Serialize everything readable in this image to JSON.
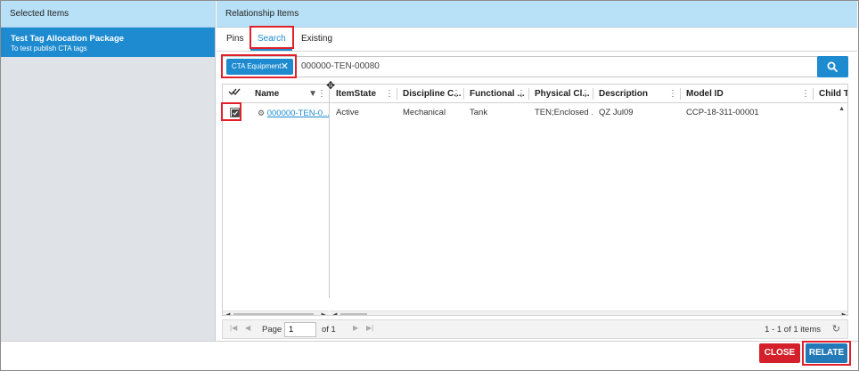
{
  "left_panel": {
    "header": "Selected Items",
    "selected_item": {
      "title": "Test Tag Allocation Package",
      "subtitle": "To test publish CTA tags"
    }
  },
  "right_panel": {
    "header": "Relationship Items",
    "tabs": [
      {
        "label": "Pins",
        "active": false
      },
      {
        "label": "Search",
        "active": true
      },
      {
        "label": "Existing",
        "active": false
      }
    ],
    "search": {
      "chip_label": "CTA Equipment",
      "chip_close_icon": "close-icon",
      "query_value": "000000-TEN-00080",
      "button_icon": "search-icon"
    },
    "grid": {
      "select_all_icon": "double-check-icon",
      "columns": [
        {
          "label": "Name",
          "filter_icon": "filter-icon"
        },
        {
          "label": "ItemState"
        },
        {
          "label": "Discipline C..."
        },
        {
          "label": "Functional ..."
        },
        {
          "label": "Physical Cl..."
        },
        {
          "label": "Description"
        },
        {
          "label": "Model ID"
        },
        {
          "label": "Child T"
        }
      ],
      "rows": [
        {
          "checked": true,
          "name": "000000-TEN-0...",
          "itemstate": "Active",
          "discipline": "Mechanical",
          "functional": "Tank",
          "physical": "TEN;Enclosed ...",
          "description": "QZ Jul09",
          "model_id": "CCP-18-311-00001",
          "child": ""
        }
      ]
    },
    "pager": {
      "page_label": "Page",
      "page_value": "1",
      "of_label": "of 1",
      "count_label": "1 - 1 of 1 items"
    }
  },
  "footer": {
    "close_label": "CLOSE",
    "relate_label": "RELATE",
    "close_color": "#d4202a",
    "relate_color": "#2479b8"
  },
  "colors": {
    "accent": "#1e8bd0",
    "header_bg": "#b8e0f6",
    "highlight": "#e0202a"
  }
}
